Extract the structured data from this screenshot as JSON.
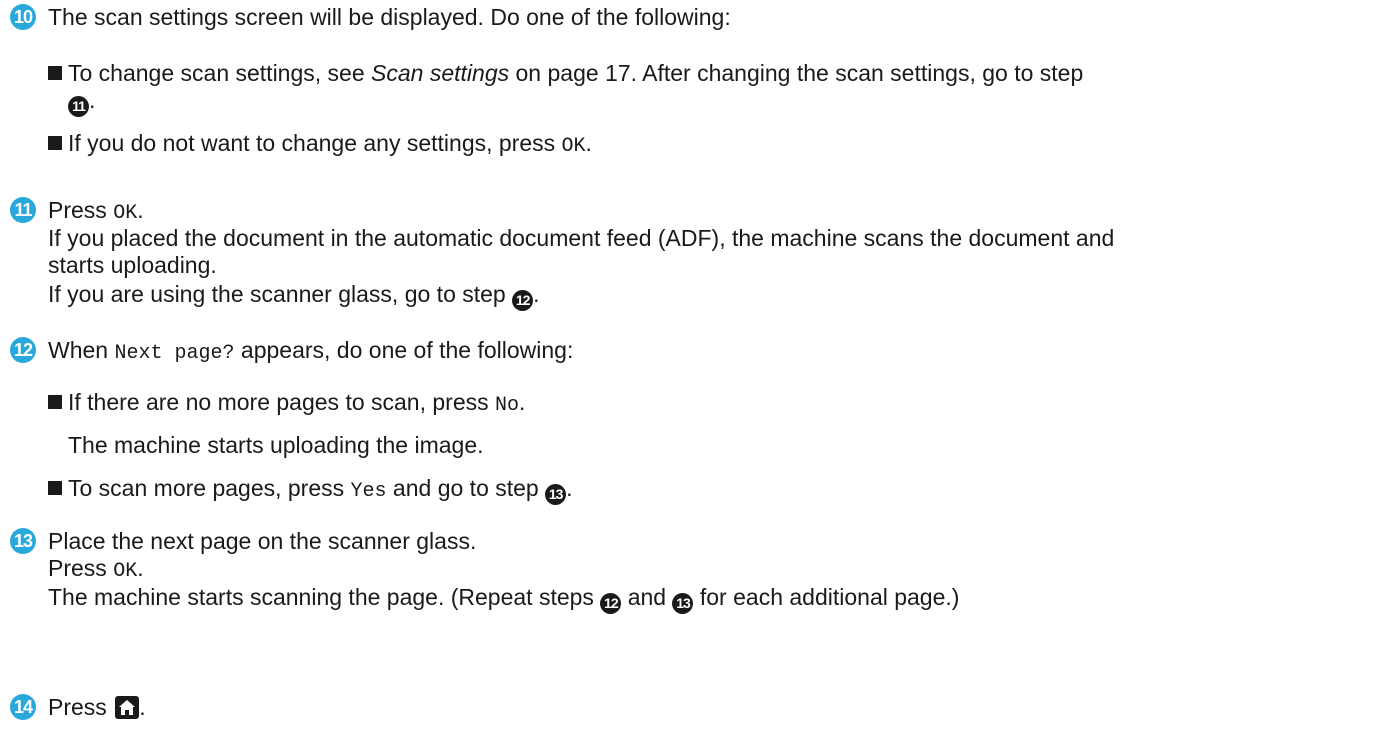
{
  "steps": {
    "s10": {
      "num": "10",
      "text": "The scan settings screen will be displayed. Do one of the following:",
      "b1_pre": "To change scan settings, see ",
      "b1_link": "Scan settings",
      "b1_post": " on page 17. After changing the scan settings, go to step",
      "b1_ref": "11",
      "b1_end": ".",
      "b2_pre": "If you do not want to change any settings, press ",
      "b2_code": "OK",
      "b2_end": "."
    },
    "s11": {
      "num": "11",
      "l1_pre": "Press ",
      "l1_code": "OK",
      "l1_end": ".",
      "l2": "If you placed the document in the automatic document feed (ADF), the machine scans the document and",
      "l3": "starts uploading.",
      "l4_pre": "If you are using the scanner glass, go to step ",
      "l4_ref": "12",
      "l4_end": "."
    },
    "s12": {
      "num": "12",
      "l1_pre": "When ",
      "l1_code": "Next page?",
      "l1_post": " appears, do one of the following:",
      "b1_pre": "If there are no more pages to scan, press ",
      "b1_code": "No",
      "b1_end": ".",
      "b1_sub": "The machine starts uploading the image.",
      "b2_pre": "To scan more pages, press ",
      "b2_code": "Yes",
      "b2_post": " and go to step ",
      "b2_ref": "13",
      "b2_end": "."
    },
    "s13": {
      "num": "13",
      "l1": "Place the next page on the scanner glass.",
      "l2_pre": "Press ",
      "l2_code": "OK",
      "l2_end": ".",
      "l3_pre": "The machine starts scanning the page. (Repeat steps ",
      "l3_ref1": "12",
      "l3_mid": " and ",
      "l3_ref2": "13",
      "l3_end": " for each additional page.)"
    },
    "s14": {
      "num": "14",
      "l1_pre": "Press ",
      "icon": "home-icon",
      "l1_end": "."
    }
  }
}
